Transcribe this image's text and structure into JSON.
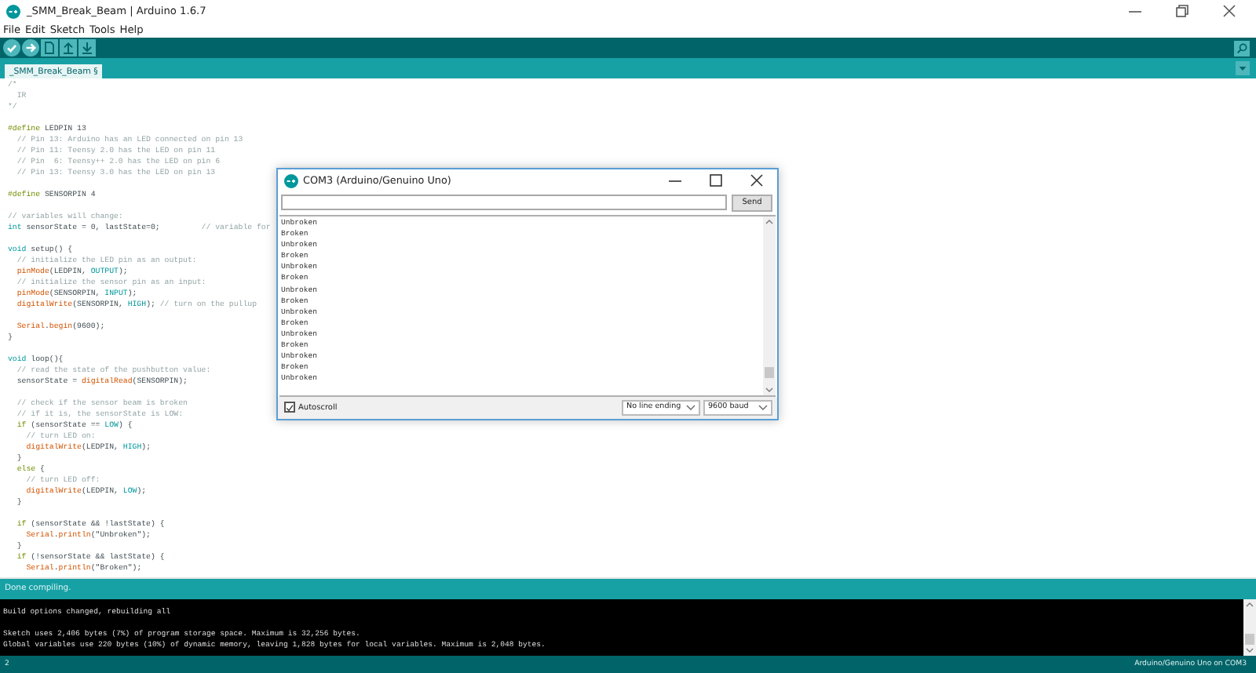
{
  "window": {
    "title": "_SMM_Break_Beam | Arduino 1.6.7"
  },
  "menu": [
    {
      "label": "File"
    },
    {
      "label": "Edit"
    },
    {
      "label": "Sketch"
    },
    {
      "label": "Tools"
    },
    {
      "label": "Help"
    }
  ],
  "toolbar": [
    {
      "kind": "verify"
    },
    {
      "kind": "upload"
    },
    {
      "kind": "new"
    },
    {
      "kind": "open"
    },
    {
      "kind": "save"
    }
  ],
  "tabs": [
    {
      "label": "_SMM_Break_Beam §",
      "selected": true
    }
  ],
  "code": [
    {
      "parts": [
        {
          "text": "/*",
          "kind": "comment"
        }
      ]
    },
    {
      "parts": [
        {
          "text": "  IR",
          "kind": "comment"
        }
      ]
    },
    {
      "parts": [
        {
          "text": "*/",
          "kind": "comment"
        }
      ]
    },
    {
      "gap_before": true,
      "parts": [
        {
          "text": "#define",
          "kind": "keyword"
        },
        {
          "text": " LEDPIN 13",
          "kind": "plain"
        }
      ]
    },
    {
      "parts": [
        {
          "text": "  // Pin 13: Arduino has an LED connected on pin 13",
          "kind": "comment"
        }
      ]
    },
    {
      "parts": [
        {
          "text": "  // Pin 11: Teensy 2.0 has the LED on pin 11",
          "kind": "comment"
        }
      ]
    },
    {
      "parts": [
        {
          "text": "  // Pin  6: Teensy++ 2.0 has the LED on pin 6",
          "kind": "comment"
        }
      ]
    },
    {
      "parts": [
        {
          "text": "  // Pin 13: Teensy 3.0 has the LED on pin 13",
          "kind": "comment"
        }
      ]
    },
    {
      "gap_before": true,
      "parts": [
        {
          "text": "#define",
          "kind": "keyword"
        },
        {
          "text": " SENSORPIN 4",
          "kind": "plain"
        }
      ]
    },
    {
      "gap_before": true,
      "parts": [
        {
          "text": "// variables will change:",
          "kind": "comment"
        }
      ]
    },
    {
      "parts": [
        {
          "text": "int",
          "kind": "type"
        },
        {
          "text": " sensorState = 0, lastState=0;         ",
          "kind": "plain"
        },
        {
          "text": "// variable for",
          "kind": "comment"
        }
      ]
    },
    {
      "gap_before": true,
      "parts": [
        {
          "text": "void",
          "kind": "type"
        },
        {
          "text": " setup() {",
          "kind": "plain"
        }
      ]
    },
    {
      "parts": [
        {
          "text": "  // initialize the LED pin as an output:",
          "kind": "comment"
        }
      ]
    },
    {
      "parts": [
        {
          "text": "  pinMode",
          "kind": "function"
        },
        {
          "text": "(LEDPIN, ",
          "kind": "plain"
        },
        {
          "text": "OUTPUT",
          "kind": "constant"
        },
        {
          "text": ");",
          "kind": "plain"
        }
      ]
    },
    {
      "parts": [
        {
          "text": "  // initialize the sensor pin as an input:",
          "kind": "comment"
        }
      ]
    },
    {
      "parts": [
        {
          "text": "  pinMode",
          "kind": "function"
        },
        {
          "text": "(SENSORPIN, ",
          "kind": "plain"
        },
        {
          "text": "INPUT",
          "kind": "constant"
        },
        {
          "text": ");",
          "kind": "plain"
        }
      ]
    },
    {
      "parts": [
        {
          "text": "  digitalWrite",
          "kind": "function"
        },
        {
          "text": "(SENSORPIN, ",
          "kind": "plain"
        },
        {
          "text": "HIGH",
          "kind": "constant"
        },
        {
          "text": "); ",
          "kind": "plain"
        },
        {
          "text": "// turn on the pullup",
          "kind": "comment"
        }
      ]
    },
    {
      "gap_before": true,
      "parts": [
        {
          "text": "  Serial",
          "kind": "function"
        },
        {
          "text": ".",
          "kind": "plain"
        },
        {
          "text": "begin",
          "kind": "function"
        },
        {
          "text": "(9600);",
          "kind": "plain"
        }
      ]
    },
    {
      "parts": [
        {
          "text": "}",
          "kind": "plain"
        }
      ]
    },
    {
      "gap_before": true,
      "parts": [
        {
          "text": "void",
          "kind": "type"
        },
        {
          "text": " loop(){",
          "kind": "plain"
        }
      ]
    },
    {
      "parts": [
        {
          "text": "  // read the state of the pushbutton value:",
          "kind": "comment"
        }
      ]
    },
    {
      "parts": [
        {
          "text": "  sensorState = ",
          "kind": "plain"
        },
        {
          "text": "digitalRead",
          "kind": "function"
        },
        {
          "text": "(SENSORPIN);",
          "kind": "plain"
        }
      ]
    },
    {
      "gap_before": true,
      "parts": [
        {
          "text": "  // check if the sensor beam is broken",
          "kind": "comment"
        }
      ]
    },
    {
      "parts": [
        {
          "text": "  // if it is, the sensorState is LOW:",
          "kind": "comment"
        }
      ]
    },
    {
      "parts": [
        {
          "text": "  if",
          "kind": "keyword"
        },
        {
          "text": " (sensorState == ",
          "kind": "plain"
        },
        {
          "text": "LOW",
          "kind": "constant"
        },
        {
          "text": ") {",
          "kind": "plain"
        }
      ]
    },
    {
      "parts": [
        {
          "text": "    // turn LED on:",
          "kind": "comment"
        }
      ]
    },
    {
      "parts": [
        {
          "text": "    digitalWrite",
          "kind": "function"
        },
        {
          "text": "(LEDPIN, ",
          "kind": "plain"
        },
        {
          "text": "HIGH",
          "kind": "constant"
        },
        {
          "text": ");",
          "kind": "plain"
        }
      ]
    },
    {
      "parts": [
        {
          "text": "  }",
          "kind": "plain"
        }
      ]
    },
    {
      "parts": [
        {
          "text": "  else",
          "kind": "keyword"
        },
        {
          "text": " {",
          "kind": "plain"
        }
      ]
    },
    {
      "parts": [
        {
          "text": "    // turn LED off:",
          "kind": "comment"
        }
      ]
    },
    {
      "parts": [
        {
          "text": "    digitalWrite",
          "kind": "function"
        },
        {
          "text": "(LEDPIN, ",
          "kind": "plain"
        },
        {
          "text": "LOW",
          "kind": "constant"
        },
        {
          "text": ");",
          "kind": "plain"
        }
      ]
    },
    {
      "parts": [
        {
          "text": "  }",
          "kind": "plain"
        }
      ]
    },
    {
      "gap_before": true,
      "parts": [
        {
          "text": "  if",
          "kind": "keyword"
        },
        {
          "text": " (sensorState && !lastState) {",
          "kind": "plain"
        }
      ]
    },
    {
      "parts": [
        {
          "text": "    Serial",
          "kind": "function"
        },
        {
          "text": ".",
          "kind": "plain"
        },
        {
          "text": "println",
          "kind": "function"
        },
        {
          "text": "(\"Unbroken\");",
          "kind": "plain"
        }
      ]
    },
    {
      "parts": [
        {
          "text": "  }",
          "kind": "plain"
        }
      ]
    },
    {
      "parts": [
        {
          "text": "  if",
          "kind": "keyword"
        },
        {
          "text": " (!sensorState && lastState) {",
          "kind": "plain"
        }
      ]
    },
    {
      "parts": [
        {
          "text": "    Serial",
          "kind": "function"
        },
        {
          "text": ".",
          "kind": "plain"
        },
        {
          "text": "println",
          "kind": "function"
        },
        {
          "text": "(\"Broken\");",
          "kind": "plain"
        }
      ]
    }
  ],
  "status_message": "Done compiling.",
  "console": [
    {
      "text": "Build options changed, rebuilding all",
      "gap_before": false
    },
    {
      "text": "Sketch uses 2,406 bytes (7%) of program storage space. Maximum is 32,256 bytes.",
      "gap_before": true
    },
    {
      "text": "Global variables use 220 bytes (10%) of dynamic memory, leaving 1,828 bytes for local variables. Maximum is 2,048 bytes.",
      "gap_before": false
    }
  ],
  "status_bar": {
    "line": "2",
    "board": "Arduino/Genuino Uno on COM3"
  },
  "serial_monitor": {
    "title": "COM3 (Arduino/Genuino Uno)",
    "send_button": "Send",
    "output": [
      "Unbroken",
      "Broken",
      "Unbroken",
      "Broken",
      "Unbroken",
      "Broken",
      "Unbroken",
      "Broken",
      "Unbroken",
      "Broken",
      "Unbroken",
      "Broken",
      "Unbroken",
      "Broken",
      "Unbroken"
    ],
    "autoscroll": {
      "label": "Autoscroll",
      "checked": true
    },
    "line_ending": "No line ending",
    "baud": "9600 baud"
  }
}
